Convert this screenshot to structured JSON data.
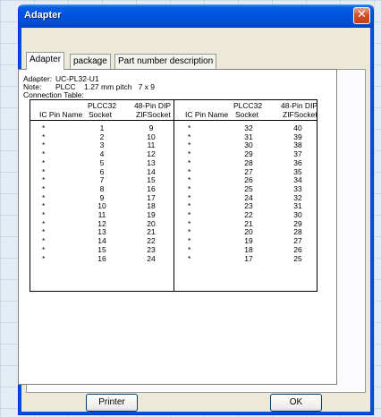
{
  "window": {
    "title": "Adapter",
    "close_glyph": "✕"
  },
  "tabs": [
    {
      "label": "Adapter",
      "active": true
    },
    {
      "label": "package",
      "active": false
    },
    {
      "label": "Part number description",
      "active": false
    }
  ],
  "info": {
    "adapter_label": "Adapter:",
    "adapter_value": "UC-PL32-U1",
    "note_label": "Note:",
    "note_value": "PLCC    1.27 mm pitch   7 x 9",
    "connection_table_label": "Connection Table:"
  },
  "table": {
    "headers": {
      "ic_pin_name": "IC Pin Name",
      "plcc32": "PLCC32",
      "socket": "Socket",
      "dip48": "48-Pin DIP",
      "zifsocket": "ZIFSocket"
    },
    "bullet": "*",
    "left_socket": [
      "1",
      "2",
      "3",
      "4",
      "5",
      "6",
      "7",
      "8",
      "9",
      "10",
      "11",
      "12",
      "13",
      "14",
      "15",
      "16"
    ],
    "left_zif": [
      "9",
      "10",
      "11",
      "12",
      "13",
      "14",
      "15",
      "16",
      "17",
      "18",
      "19",
      "20",
      "21",
      "22",
      "23",
      "24"
    ],
    "right_socket": [
      "32",
      "31",
      "30",
      "29",
      "28",
      "27",
      "26",
      "25",
      "24",
      "23",
      "22",
      "21",
      "20",
      "19",
      "18",
      "17"
    ],
    "right_zif": [
      "40",
      "39",
      "38",
      "37",
      "36",
      "35",
      "34",
      "33",
      "32",
      "31",
      "30",
      "29",
      "28",
      "27",
      "26",
      "25"
    ]
  },
  "buttons": {
    "printer": "Printer",
    "ok": "OK"
  }
}
